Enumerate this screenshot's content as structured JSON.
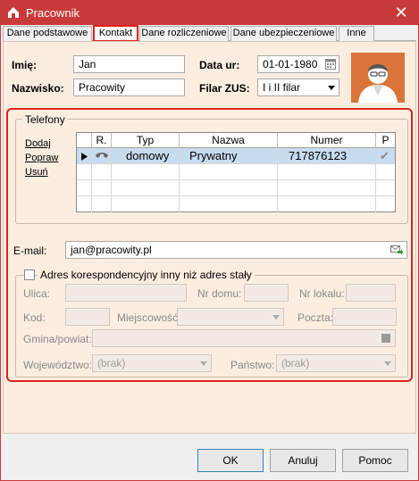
{
  "window": {
    "title": "Pracownik",
    "close": "✕"
  },
  "tabs": [
    "Dane podstawowe",
    "Kontakt",
    "Dane rozliczeniowe",
    "Dane ubezpieczeniowe",
    "Inne"
  ],
  "header": {
    "imie_label": "Imię:",
    "imie_value": "Jan",
    "nazwisko_label": "Nazwisko:",
    "nazwisko_value": "Pracowity",
    "data_ur_label": "Data ur:",
    "data_ur_value": "01-01-1980",
    "filar_label": "Filar ZUS:",
    "filar_value": "I i II filar"
  },
  "telefony": {
    "title": "Telefony",
    "actions": [
      "Dodaj",
      "Popraw",
      "Usuń"
    ],
    "columns": [
      "R.",
      "Typ",
      "Nazwa",
      "Numer",
      "P"
    ],
    "rows": [
      {
        "typ": "domowy",
        "nazwa": "Prywatny",
        "numer": "717876123",
        "p": "✔"
      }
    ]
  },
  "email": {
    "label": "E-mail:",
    "value": "jan@pracowity.pl"
  },
  "adres": {
    "checkbox_label": "Adres korespondencyjny inny niż adres stały",
    "ulica": "Ulica:",
    "nr_domu": "Nr domu:",
    "nr_lokalu": "Nr lokalu:",
    "kod": "Kod:",
    "miejscowosc": "Miejscowość:",
    "poczta": "Poczta:",
    "gmina": "Gmina/powiat:",
    "wojewodztwo_label": "Województwo:",
    "wojewodztwo_value": "(brak)",
    "panstwo_label": "Państwo:",
    "panstwo_value": "(brak)"
  },
  "buttons": {
    "ok": "OK",
    "anuluj": "Anuluj",
    "pomoc": "Pomoc"
  }
}
